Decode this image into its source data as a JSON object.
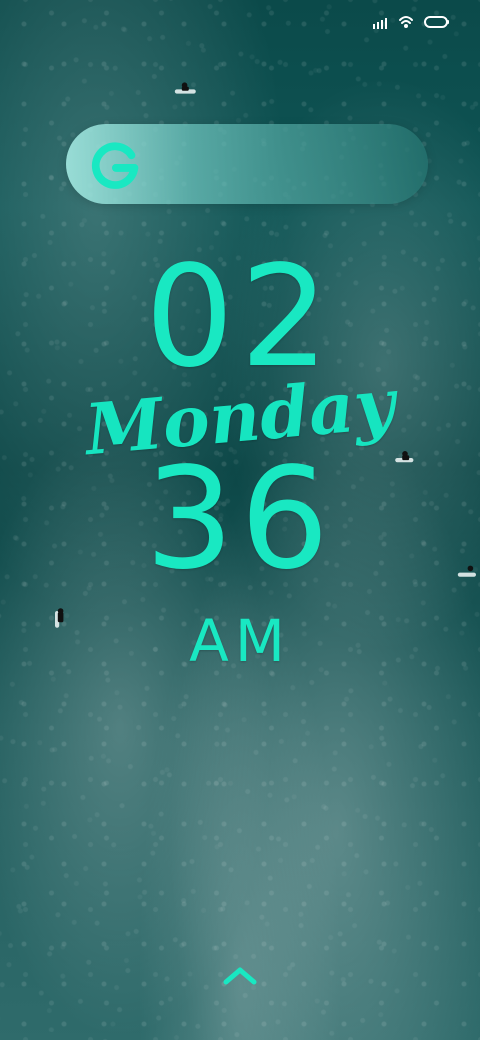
{
  "status": {
    "icons": [
      "signal-bars-icon",
      "wifi-icon",
      "battery-icon"
    ]
  },
  "search": {
    "logo_letter": "G"
  },
  "clock": {
    "hour": "02",
    "day": "Monday",
    "minute": "36",
    "period": "AM"
  },
  "colors": {
    "accent": "#19e8c2",
    "sea_dark": "#0b4a4a",
    "sea_mid": "#0f5555",
    "sea_light": "#2f6b6b"
  },
  "gestures": {
    "swipe_icon": "chevron-up-icon"
  }
}
